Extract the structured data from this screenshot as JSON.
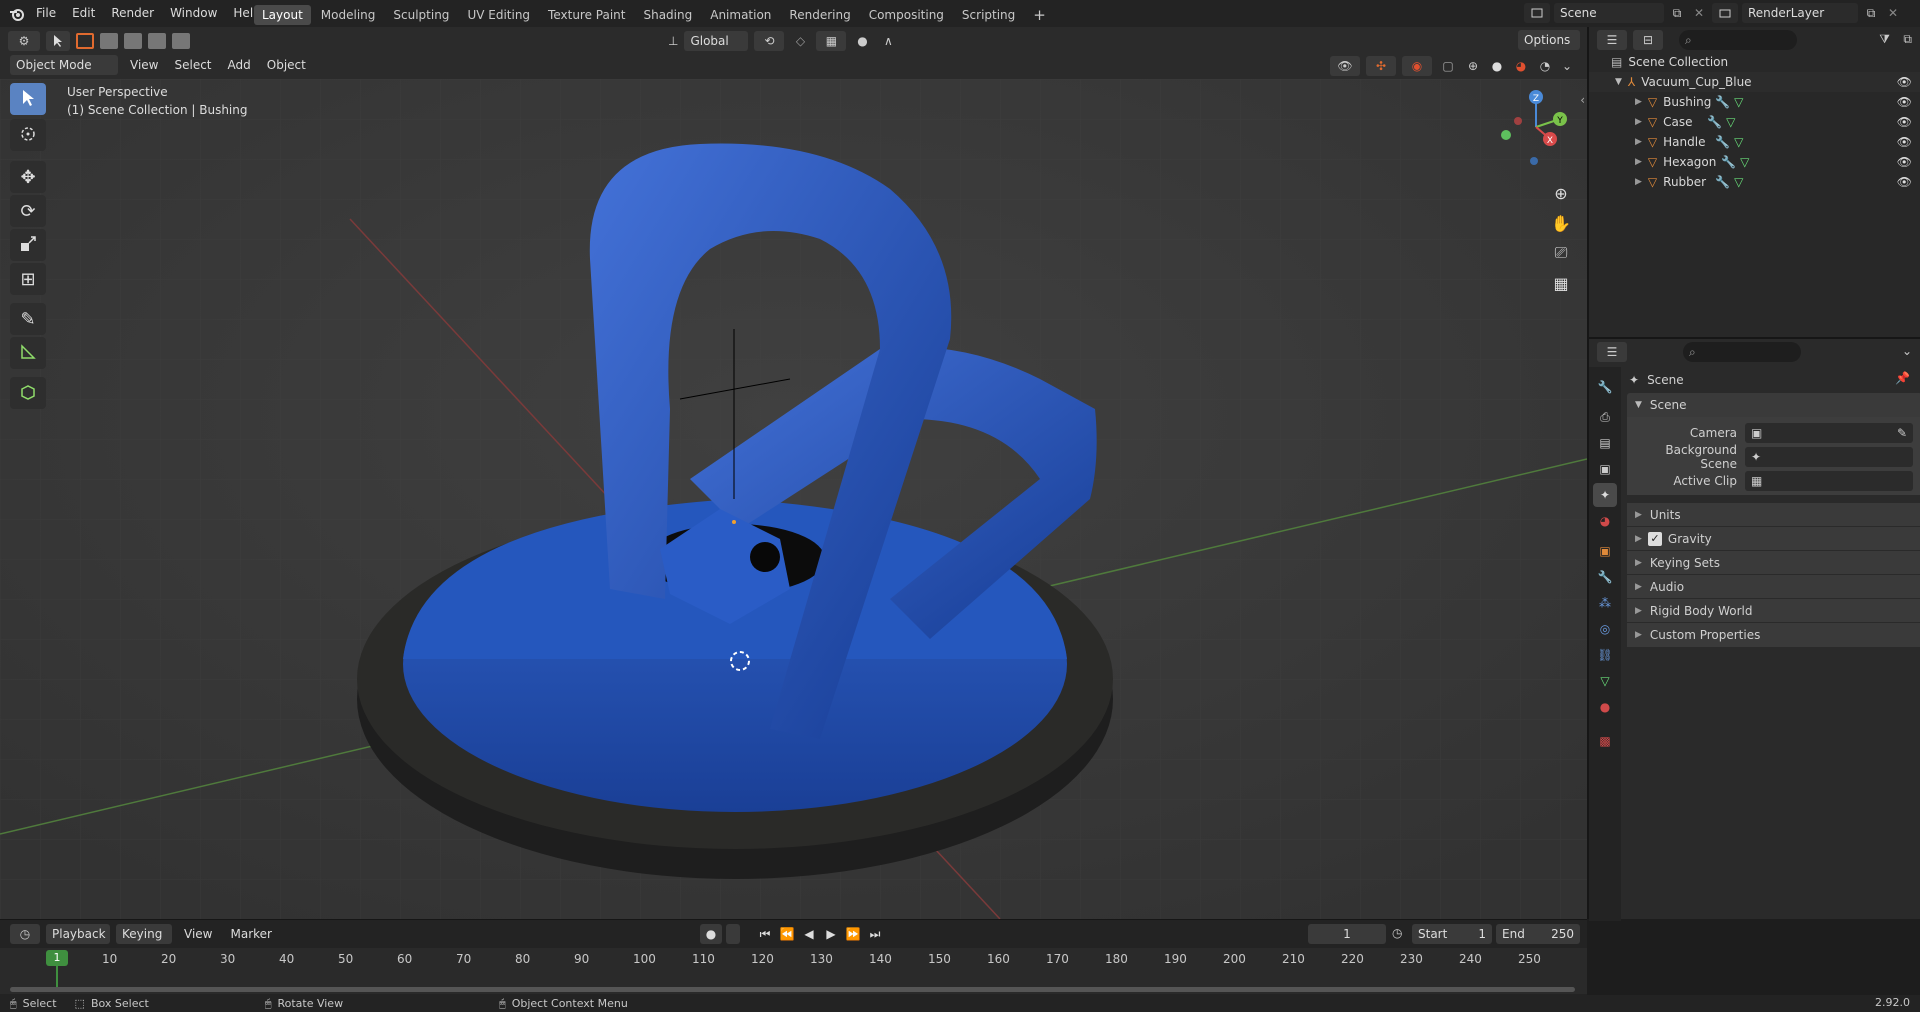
{
  "topbar": {
    "menus": [
      "File",
      "Edit",
      "Render",
      "Window",
      "Help"
    ],
    "workspaces": [
      "Layout",
      "Modeling",
      "Sculpting",
      "UV Editing",
      "Texture Paint",
      "Shading",
      "Animation",
      "Rendering",
      "Compositing",
      "Scripting"
    ],
    "add_tab": "+",
    "scene_name": "Scene",
    "view_layer": "RenderLayer"
  },
  "header3d": {
    "transform_orientation": "Global",
    "options": "Options",
    "mode": "Object Mode",
    "menus": [
      "View",
      "Select",
      "Add",
      "Object"
    ]
  },
  "viewport": {
    "perspective_label": "User Perspective",
    "collection_label": "(1) Scene Collection | Bushing",
    "accent": "#5a83c2",
    "object_color": "#1f4fb0",
    "gizmo": {
      "x": "X",
      "y": "Y",
      "z": "Z"
    }
  },
  "outliner": {
    "root": "Scene Collection",
    "collection": "Vacuum_Cup_Blue",
    "objects": [
      {
        "name": "Bushing"
      },
      {
        "name": "Case"
      },
      {
        "name": "Handle"
      },
      {
        "name": "Hexagon"
      },
      {
        "name": "Rubber"
      }
    ]
  },
  "properties": {
    "header": "Scene",
    "panel_title": "Scene",
    "fields": [
      {
        "label": "Camera"
      },
      {
        "label": "Background Scene"
      },
      {
        "label": "Active Clip"
      }
    ],
    "subpanels": [
      "Units",
      "Gravity",
      "Keying Sets",
      "Audio",
      "Rigid Body World",
      "Custom Properties"
    ],
    "gravity_checked": true
  },
  "timeline": {
    "menus": [
      "Playback",
      "Keying",
      "View",
      "Marker"
    ],
    "current_frame": "1",
    "start_label": "Start",
    "start": "1",
    "end_label": "End",
    "end": "250",
    "playhead": "1",
    "ticks": [
      "10",
      "20",
      "30",
      "40",
      "50",
      "60",
      "70",
      "80",
      "90",
      "100",
      "110",
      "120",
      "130",
      "140",
      "150",
      "160",
      "170",
      "180",
      "190",
      "200",
      "210",
      "220",
      "230",
      "240",
      "250"
    ]
  },
  "statusbar": {
    "select": "Select",
    "box_select": "Box Select",
    "rotate": "Rotate View",
    "context_menu": "Object Context Menu",
    "version": "2.92.0"
  }
}
